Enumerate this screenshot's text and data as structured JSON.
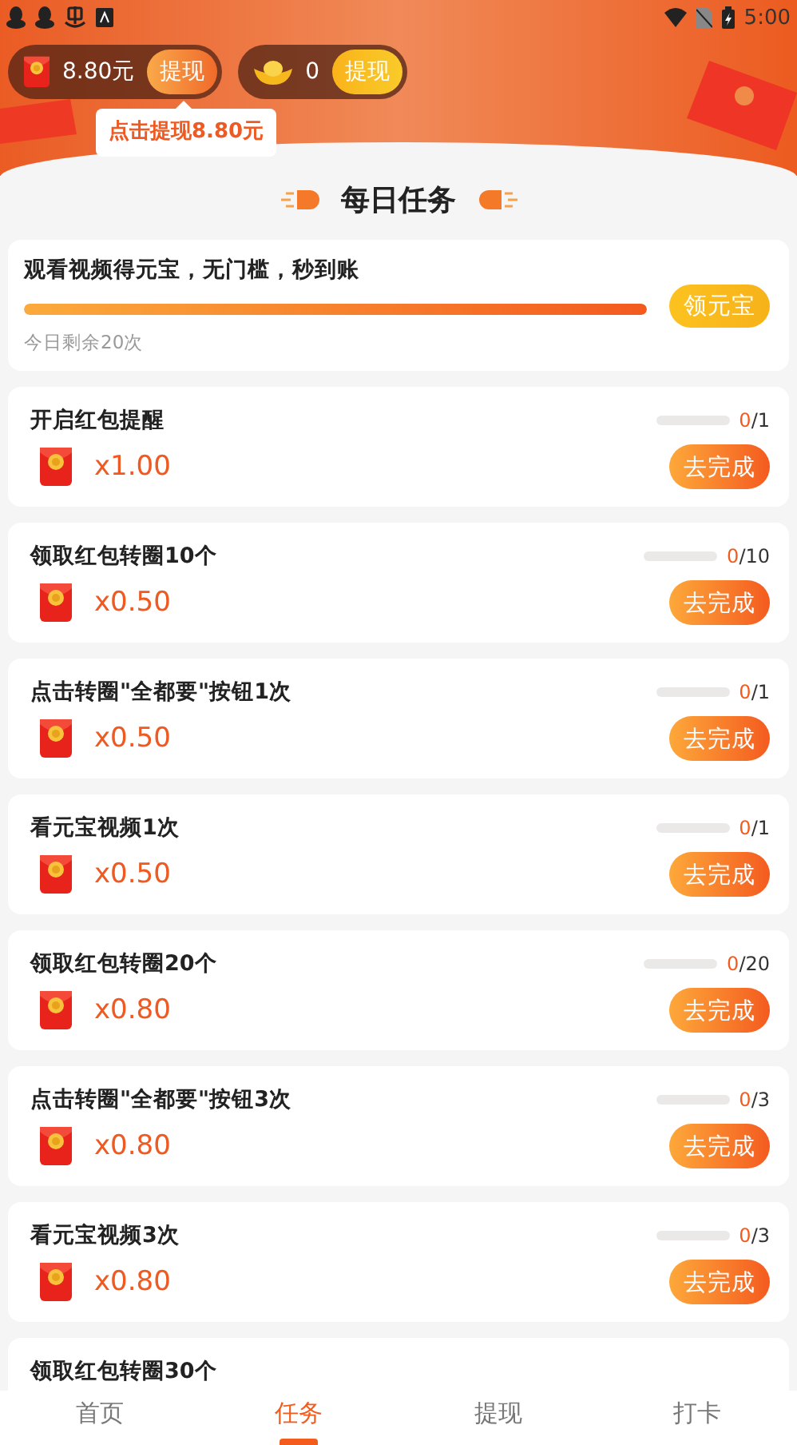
{
  "status_bar": {
    "time": "5:00"
  },
  "wallet": {
    "cash": "8.80元",
    "cash_button": "提现",
    "ingots": "0",
    "ingot_button": "提现",
    "tooltip": "点击提现8.80元"
  },
  "section_title": "每日任务",
  "video_task": {
    "title": "观看视频得元宝，无门槛，秒到账",
    "level": 1,
    "remaining": "今日剩余20次",
    "button": "领元宝"
  },
  "tasks": [
    {
      "title": "开启红包提醒",
      "done": "0",
      "total": "/1",
      "reward": "x1.00",
      "button": "去完成"
    },
    {
      "title": "领取红包转圈10个",
      "done": "0",
      "total": "/10",
      "reward": "x0.50",
      "button": "去完成"
    },
    {
      "title": "点击转圈\"全都要\"按钮1次",
      "done": "0",
      "total": "/1",
      "reward": "x0.50",
      "button": "去完成"
    },
    {
      "title": "看元宝视频1次",
      "done": "0",
      "total": "/1",
      "reward": "x0.50",
      "button": "去完成"
    },
    {
      "title": "领取红包转圈20个",
      "done": "0",
      "total": "/20",
      "reward": "x0.80",
      "button": "去完成"
    },
    {
      "title": "点击转圈\"全都要\"按钮3次",
      "done": "0",
      "total": "/3",
      "reward": "x0.80",
      "button": "去完成"
    },
    {
      "title": "看元宝视频3次",
      "done": "0",
      "total": "/3",
      "reward": "x0.80",
      "button": "去完成"
    },
    {
      "title": "领取红包转圈30个"
    }
  ],
  "nav": [
    {
      "label": "首页",
      "selected": false
    },
    {
      "label": "任务",
      "selected": true
    },
    {
      "label": "提现",
      "selected": false
    },
    {
      "label": "打卡",
      "selected": false
    }
  ]
}
